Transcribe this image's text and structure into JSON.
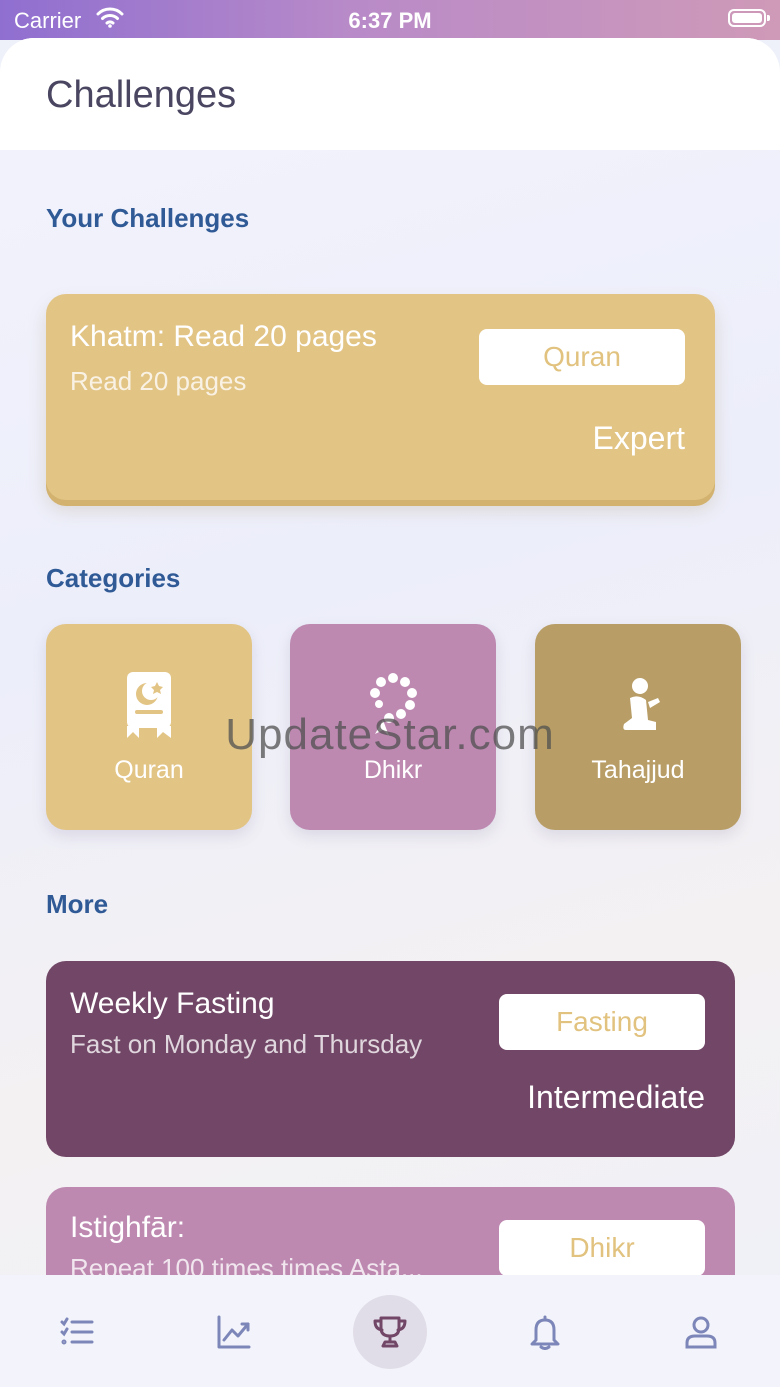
{
  "status_bar": {
    "carrier": "Carrier",
    "time": "6:37 PM"
  },
  "header": {
    "title": "Challenges"
  },
  "sections": {
    "your_challenges": "Your Challenges",
    "categories": "Categories",
    "more": "More"
  },
  "your_challenges": [
    {
      "title": "Khatm: Read 20 pages",
      "subtitle": "Read 20 pages",
      "tag": "Quran",
      "level": "Expert",
      "color": "#e2c485"
    }
  ],
  "categories": [
    {
      "label": "Quran",
      "icon": "quran-book-icon",
      "color": "#e2c485"
    },
    {
      "label": "Dhikr",
      "icon": "prayer-beads-icon",
      "color": "#bd89b1"
    },
    {
      "label": "Tahajjud",
      "icon": "praying-person-icon",
      "color": "#b89e66"
    }
  ],
  "more": [
    {
      "title": "Weekly Fasting",
      "subtitle": "Fast on Monday and Thursday",
      "tag": "Fasting",
      "level": "Intermediate",
      "color": "#714666"
    },
    {
      "title": "Istighfār:",
      "subtitle": "Repeat 100 times times Asta...",
      "tag": "Dhikr",
      "level": "",
      "color": "#bd89b1"
    }
  ],
  "watermark": "UpdateStar.com",
  "tabbar": {
    "items": [
      {
        "icon": "list-icon"
      },
      {
        "icon": "chart-icon"
      },
      {
        "icon": "trophy-icon",
        "active": true
      },
      {
        "icon": "bell-icon"
      },
      {
        "icon": "profile-icon"
      }
    ]
  },
  "colors": {
    "accent": "#2f5a96",
    "tag_text": "#e1c27e",
    "tab_icon": "#7d86b8",
    "tab_active_icon": "#714666"
  }
}
